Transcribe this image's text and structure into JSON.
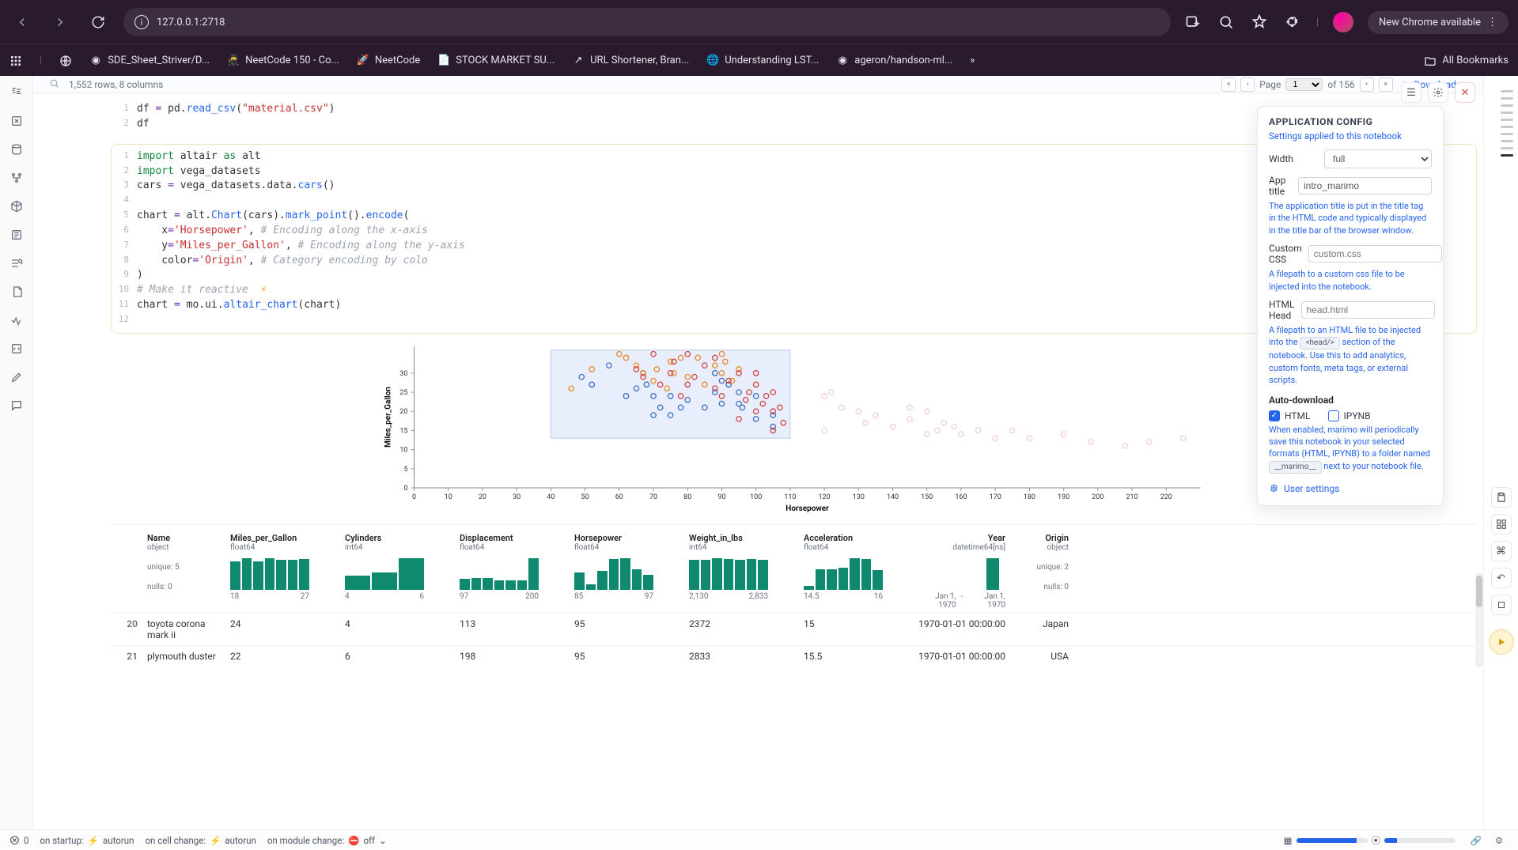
{
  "browser": {
    "url": "127.0.0.1:2718",
    "new_chrome": "New Chrome available",
    "bookmarks": [
      {
        "icon": "github",
        "label": "SDE_Sheet_Striver/D..."
      },
      {
        "icon": "ninja",
        "label": "NeetCode 150 - Co..."
      },
      {
        "icon": "rocket",
        "label": "NeetCode"
      },
      {
        "icon": "doc",
        "label": "STOCK MARKET SU..."
      },
      {
        "icon": "arrow",
        "label": "URL Shortener, Bran..."
      },
      {
        "icon": "globe",
        "label": "Understanding LST..."
      },
      {
        "icon": "github",
        "label": "ageron/handson-ml..."
      }
    ],
    "all_bookmarks": "All Bookmarks"
  },
  "table_header": {
    "rows_cols": "1,552 rows, 8 columns",
    "page_label": "Page",
    "page_val": "1",
    "of_label": "of 156",
    "download": "Download"
  },
  "code_cells": [
    {
      "lines": [
        {
          "n": 1,
          "html": "df <span class='op'>=</span> pd.<span class='fn'>read_csv</span>(<span class='st'>\"material.csv\"</span>)"
        },
        {
          "n": 2,
          "html": "df"
        }
      ]
    },
    {
      "active": true,
      "lines": [
        {
          "n": 1,
          "html": "<span class='kw'>import</span> altair <span class='kw'>as</span> alt"
        },
        {
          "n": 2,
          "html": "<span class='kw'>import</span> vega_datasets"
        },
        {
          "n": 3,
          "html": "cars <span class='op'>=</span> vega_datasets.data.<span class='fn'>cars</span>()"
        },
        {
          "n": 4,
          "html": ""
        },
        {
          "n": 5,
          "html": "chart <span class='op'>=</span> alt.<span class='fn'>Chart</span>(cars).<span class='fn'>mark_point</span>().<span class='fn'>encode</span>("
        },
        {
          "n": 6,
          "html": "    x<span class='op'>=</span><span class='st'>'Horsepower'</span>, <span class='cm'># Encoding along the x-axis</span>"
        },
        {
          "n": 7,
          "html": "    y<span class='op'>=</span><span class='st'>'Miles_per_Gallon'</span>, <span class='cm'># Encoding along the y-axis</span>"
        },
        {
          "n": 8,
          "html": "    color<span class='op'>=</span><span class='st'>'Origin'</span>, <span class='cm'># Category encoding by colo</span>"
        },
        {
          "n": 9,
          "html": ")"
        },
        {
          "n": 10,
          "html": "<span class='cm'># Make it reactive</span>  <span class='bolt'>⚡</span>"
        },
        {
          "n": 11,
          "html": "chart <span class='op'>=</span> mo.ui.<span class='fn'>altair_chart</span>(chart)"
        },
        {
          "n": 12,
          "html": ""
        }
      ]
    }
  ],
  "chart_data": {
    "type": "scatter",
    "xlabel": "Horsepower",
    "ylabel": "Miles_per_Gallon",
    "x_ticks": [
      0,
      10,
      20,
      30,
      40,
      50,
      60,
      70,
      80,
      90,
      100,
      110,
      120,
      130,
      140,
      150,
      160,
      170,
      180,
      190,
      200,
      210,
      220
    ],
    "y_ticks": [
      0,
      5,
      10,
      15,
      20,
      25,
      30
    ],
    "xlim": [
      0,
      230
    ],
    "ylim": [
      0,
      37
    ],
    "selection_box": {
      "x0": 40,
      "x1": 110,
      "y0": 13,
      "y1": 36
    },
    "colors": {
      "Europe": "#e8892f",
      "Japan": "#d24545",
      "USA": "#3b6fc7"
    },
    "series": [
      {
        "name": "USA",
        "color": "#3b6fc7",
        "points": [
          [
            49,
            29
          ],
          [
            52,
            27
          ],
          [
            62,
            24
          ],
          [
            65,
            26
          ],
          [
            67,
            30
          ],
          [
            68,
            27
          ],
          [
            70,
            24
          ],
          [
            70,
            19
          ],
          [
            72,
            21
          ],
          [
            75,
            24
          ],
          [
            75,
            19
          ],
          [
            78,
            21
          ],
          [
            80,
            23
          ],
          [
            85,
            21
          ],
          [
            88,
            25
          ],
          [
            88,
            30
          ],
          [
            90,
            28
          ],
          [
            90,
            22
          ],
          [
            92,
            27
          ],
          [
            95,
            22
          ],
          [
            95,
            25
          ],
          [
            96,
            21
          ],
          [
            100,
            18
          ],
          [
            100,
            24
          ],
          [
            105,
            19
          ],
          [
            105,
            16
          ],
          [
            57,
            32
          ]
        ]
      },
      {
        "name": "Europe",
        "color": "#e8892f",
        "points": [
          [
            46,
            26
          ],
          [
            52,
            31
          ],
          [
            60,
            35
          ],
          [
            62,
            34
          ],
          [
            65,
            32
          ],
          [
            67,
            30
          ],
          [
            70,
            28
          ],
          [
            71,
            31
          ],
          [
            74,
            26
          ],
          [
            75,
            33
          ],
          [
            76,
            30
          ],
          [
            78,
            34
          ],
          [
            80,
            29
          ],
          [
            83,
            34
          ],
          [
            85,
            27
          ],
          [
            88,
            32
          ],
          [
            90,
            30
          ],
          [
            91,
            33
          ],
          [
            93,
            28
          ],
          [
            95,
            31
          ],
          [
            90,
            35
          ]
        ]
      },
      {
        "name": "Japan",
        "color": "#d24545",
        "points": [
          [
            65,
            31
          ],
          [
            67,
            29
          ],
          [
            70,
            35
          ],
          [
            72,
            27
          ],
          [
            75,
            30
          ],
          [
            76,
            33
          ],
          [
            78,
            24
          ],
          [
            80,
            27
          ],
          [
            80,
            35
          ],
          [
            82,
            29
          ],
          [
            85,
            32
          ],
          [
            88,
            26
          ],
          [
            88,
            34
          ],
          [
            90,
            24
          ],
          [
            92,
            28
          ],
          [
            95,
            30
          ],
          [
            95,
            18
          ],
          [
            97,
            23
          ],
          [
            98,
            25
          ],
          [
            100,
            20
          ],
          [
            100,
            27
          ],
          [
            100,
            30
          ],
          [
            102,
            22
          ],
          [
            103,
            24
          ],
          [
            105,
            20
          ],
          [
            105,
            25
          ],
          [
            105,
            15
          ],
          [
            107,
            21
          ],
          [
            108,
            17
          ],
          [
            120,
            24
          ],
          [
            125,
            21
          ],
          [
            130,
            20
          ],
          [
            132,
            17
          ],
          [
            135,
            19
          ],
          [
            140,
            16
          ],
          [
            145,
            18
          ],
          [
            150,
            14
          ],
          [
            150,
            20
          ],
          [
            153,
            15
          ],
          [
            158,
            16
          ],
          [
            160,
            14
          ],
          [
            165,
            15
          ],
          [
            170,
            13
          ],
          [
            175,
            15
          ],
          [
            180,
            13
          ],
          [
            190,
            14
          ],
          [
            198,
            12
          ],
          [
            208,
            11
          ],
          [
            215,
            12
          ],
          [
            225,
            13
          ],
          [
            120,
            15
          ],
          [
            122,
            25
          ],
          [
            145,
            21
          ],
          [
            155,
            17
          ]
        ]
      }
    ]
  },
  "data_table": {
    "columns": [
      {
        "name": "Name",
        "type": "object",
        "meta1": "unique: 5",
        "meta2": "nulls: 0"
      },
      {
        "name": "Miles_per_Gallon",
        "type": "float64",
        "bars": [
          0.9,
          1,
          0.9,
          1,
          0.95,
          0.95,
          0.98
        ],
        "range": [
          "18",
          "27"
        ]
      },
      {
        "name": "Cylinders",
        "type": "int64",
        "bars": [
          0.45,
          0.55,
          1
        ],
        "range": [
          "4",
          "6"
        ]
      },
      {
        "name": "Displacement",
        "type": "float64",
        "bars": [
          0.35,
          0.38,
          0.38,
          0.3,
          0.3,
          0.3,
          1.0
        ],
        "range": [
          "97",
          "200"
        ]
      },
      {
        "name": "Horsepower",
        "type": "float64",
        "bars": [
          0.55,
          0.18,
          0.6,
          0.98,
          1.0,
          0.65,
          0.48
        ],
        "range": [
          "85",
          "97"
        ]
      },
      {
        "name": "Weight_in_lbs",
        "type": "int64",
        "bars": [
          0.95,
          0.95,
          1.0,
          0.98,
          0.95,
          0.98,
          0.95
        ],
        "range": [
          "2,130",
          "2,833"
        ]
      },
      {
        "name": "Acceleration",
        "type": "float64",
        "bars": [
          0.12,
          0.65,
          0.65,
          0.7,
          1.0,
          0.98,
          0.62
        ],
        "range": [
          "14.5",
          "16"
        ]
      },
      {
        "name": "Year",
        "type": "datetime64[ns]",
        "single_bar": true,
        "range": [
          "Jan 1, 1970",
          "Jan 1, 1970"
        ]
      },
      {
        "name": "Origin",
        "type": "object",
        "meta1": "unique: 2",
        "meta2": "nulls: 0"
      }
    ],
    "rows": [
      {
        "idx": 20,
        "Name": "toyota corona mark ii",
        "Miles_per_Gallon": "24",
        "Cylinders": "4",
        "Displacement": "113",
        "Horsepower": "95",
        "Weight_in_lbs": "2372",
        "Acceleration": "15",
        "Year": "1970-01-01 00:00:00",
        "Origin": "Japan"
      },
      {
        "idx": 21,
        "Name": "plymouth duster",
        "Miles_per_Gallon": "22",
        "Cylinders": "6",
        "Displacement": "198",
        "Horsepower": "95",
        "Weight_in_lbs": "2833",
        "Acceleration": "15.5",
        "Year": "1970-01-01 00:00:00",
        "Origin": "USA"
      }
    ]
  },
  "config": {
    "title": "APPLICATION CONFIG",
    "subtitle": "Settings applied to this notebook",
    "width_label": "Width",
    "width_value": "full",
    "app_title_label": "App title",
    "app_title_value": "intro_marimo",
    "app_title_help": "The application title is put in the title tag in the HTML code and typically displayed in the title bar of the browser window.",
    "css_label": "Custom CSS",
    "css_placeholder": "custom.css",
    "css_help": "A filepath to a custom css file to be injected into the notebook.",
    "head_label": "HTML Head",
    "head_placeholder": "head.html",
    "head_help_pre": "A filepath to an HTML file to be injected into the ",
    "head_help_tag": "<head/>",
    "head_help_post": " section of the notebook. Use this to add analytics, custom fonts, meta tags, or external scripts.",
    "auto_title": "Auto-download",
    "chk_html": "HTML",
    "chk_ipynb": "IPYNB",
    "auto_help_pre": "When enabled, marimo will periodically save this notebook in your selected formats (HTML, IPYNB) to a folder named ",
    "auto_help_tag": "__marimo__",
    "auto_help_post": " next to your notebook file.",
    "user_settings": "User settings"
  },
  "status": {
    "errors_count": "0",
    "startup_label": "on startup:",
    "startup_value": "autorun",
    "cell_label": "on cell change:",
    "cell_value": "autorun",
    "module_label": "on module change:",
    "module_value": "off"
  }
}
